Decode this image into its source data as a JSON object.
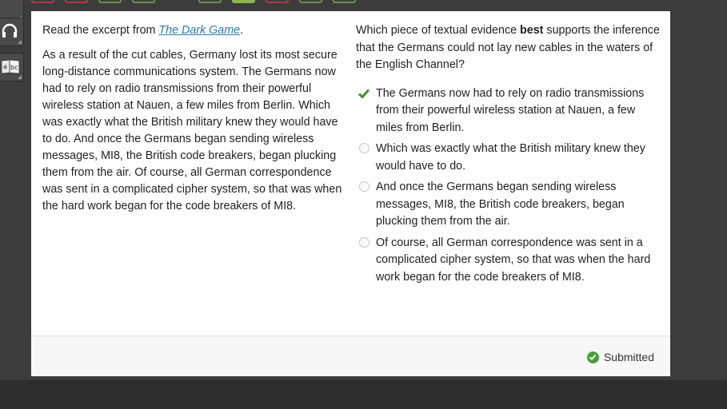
{
  "toolbar": {
    "icons": [
      "options-icon",
      "headphones-icon",
      "dictionary-icon"
    ]
  },
  "question_nav": {
    "states": [
      "red",
      "red",
      "green",
      "green",
      "green",
      "current",
      "red",
      "green",
      "green"
    ]
  },
  "passage": {
    "intro_prefix": "Read the excerpt from ",
    "title": "The Dark Game",
    "intro_suffix": ".",
    "text": "As a result of the cut cables, Germany lost its most secure long-distance communications system. The Germans now had to rely on radio transmissions from their powerful wireless station at Nauen, a few miles from Berlin. Which was exactly what the British military knew they would have to do. And once the Germans began sending wireless messages, MI8, the British code breakers, began plucking them from the air. Of course, all German correspondence was sent in a complicated cipher system, so that was when the hard work began for the code breakers of MI8."
  },
  "question": {
    "prefix": "Which piece of textual evidence ",
    "emphasis": "best",
    "suffix": " supports the inference that the Germans could not lay new cables in the waters of the English Channel?"
  },
  "options": [
    {
      "text": "The Germans now had to rely on radio transmissions from their powerful wireless station at Nauen, a few miles from Berlin.",
      "selected": true
    },
    {
      "text": "Which was exactly what the British military knew they would have to do.",
      "selected": false
    },
    {
      "text": "And once the Germans began sending wireless messages, MI8, the British code breakers, began plucking them from the air.",
      "selected": false
    },
    {
      "text": "Of course, all German correspondence was sent in a complicated cipher system, so that was when the hard work began for the code breakers of MI8.",
      "selected": false
    }
  ],
  "status": {
    "label": "Submitted"
  },
  "colors": {
    "accent_green": "#4a9e3a",
    "link": "#2a7ab0",
    "wrong": "#b23a3a",
    "current": "#8fb34f"
  }
}
